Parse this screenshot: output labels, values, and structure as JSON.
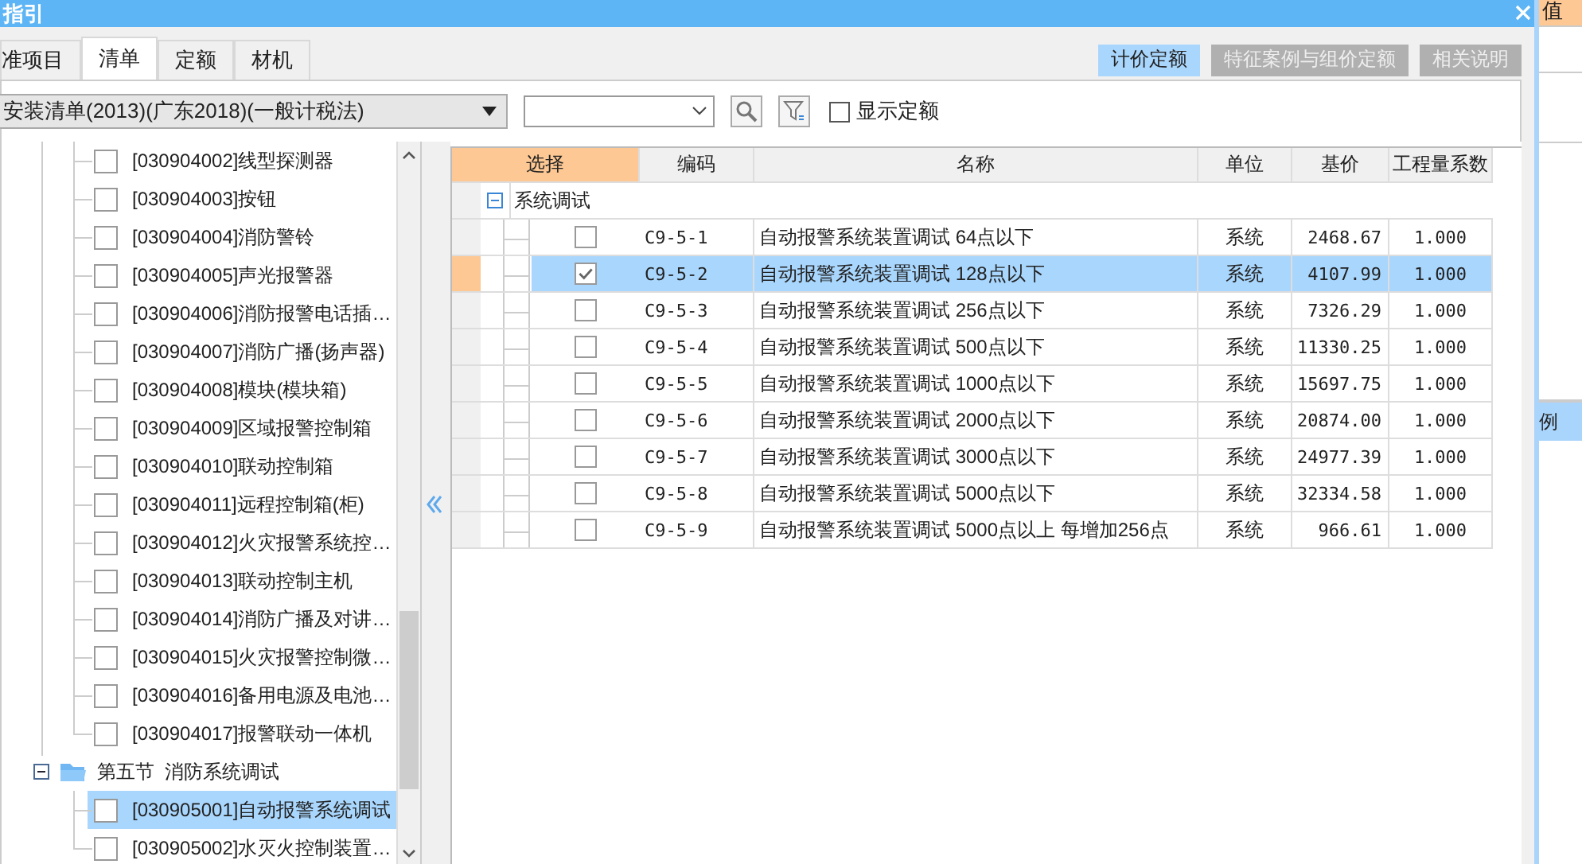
{
  "window": {
    "title": "指引"
  },
  "tabs": [
    {
      "label": "准项目",
      "selected": false
    },
    {
      "label": "清单",
      "selected": true
    },
    {
      "label": "定额",
      "selected": false
    },
    {
      "label": "材机",
      "selected": false
    }
  ],
  "view_buttons": [
    {
      "label": "计价定额",
      "selected": true
    },
    {
      "label": "特征案例与组价定额",
      "selected": false
    },
    {
      "label": "相关说明",
      "selected": false
    }
  ],
  "library": {
    "value": "安装清单(2013)(广东2018)(一般计税法)"
  },
  "show_quota": {
    "label": "显示定额",
    "checked": false
  },
  "tree": [
    {
      "children": [
        {
          "label": "[030904002]线型探测器",
          "checked": false,
          "selected": false
        },
        {
          "label": "[030904003]按钮",
          "checked": false,
          "selected": false
        },
        {
          "label": "[030904004]消防警铃",
          "checked": false,
          "selected": false
        },
        {
          "label": "[030904005]声光报警器",
          "checked": false,
          "selected": false
        },
        {
          "label": "[030904006]消防报警电话插…",
          "checked": false,
          "selected": false
        },
        {
          "label": "[030904007]消防广播(扬声器)",
          "checked": false,
          "selected": false
        },
        {
          "label": "[030904008]模块(模块箱)",
          "checked": false,
          "selected": false
        },
        {
          "label": "[030904009]区域报警控制箱",
          "checked": false,
          "selected": false
        },
        {
          "label": "[030904010]联动控制箱",
          "checked": false,
          "selected": false
        },
        {
          "label": "[030904011]远程控制箱(柜)",
          "checked": false,
          "selected": false
        },
        {
          "label": "[030904012]火灾报警系统控…",
          "checked": false,
          "selected": false
        },
        {
          "label": "[030904013]联动控制主机",
          "checked": false,
          "selected": false
        },
        {
          "label": "[030904014]消防广播及对讲…",
          "checked": false,
          "selected": false
        },
        {
          "label": "[030904015]火灾报警控制微…",
          "checked": false,
          "selected": false
        },
        {
          "label": "[030904016]备用电源及电池…",
          "checked": false,
          "selected": false
        },
        {
          "label": "[030904017]报警联动一体机",
          "checked": false,
          "selected": false
        }
      ]
    },
    {
      "label": "第五节  消防系统调试",
      "expanded": true,
      "children": [
        {
          "label": "[030905001]自动报警系统调试",
          "checked": false,
          "selected": true
        },
        {
          "label": "[030905002]水灭火控制装置…",
          "checked": false,
          "selected": false
        }
      ]
    }
  ],
  "grid": {
    "columns": [
      "选择",
      "编码",
      "名称",
      "单位",
      "基价",
      "工程量系数"
    ],
    "group": {
      "label": "系统调试",
      "expanded": true
    },
    "rows": [
      {
        "checked": false,
        "selected": false,
        "code": "C9-5-1",
        "name": "自动报警系统装置调试 64点以下",
        "unit": "系统",
        "price": "2468.67",
        "factor": "1.000"
      },
      {
        "checked": true,
        "selected": true,
        "code": "C9-5-2",
        "name": "自动报警系统装置调试 128点以下",
        "unit": "系统",
        "price": "4107.99",
        "factor": "1.000"
      },
      {
        "checked": false,
        "selected": false,
        "code": "C9-5-3",
        "name": "自动报警系统装置调试 256点以下",
        "unit": "系统",
        "price": "7326.29",
        "factor": "1.000"
      },
      {
        "checked": false,
        "selected": false,
        "code": "C9-5-4",
        "name": "自动报警系统装置调试 500点以下",
        "unit": "系统",
        "price": "11330.25",
        "factor": "1.000"
      },
      {
        "checked": false,
        "selected": false,
        "code": "C9-5-5",
        "name": "自动报警系统装置调试 1000点以下",
        "unit": "系统",
        "price": "15697.75",
        "factor": "1.000"
      },
      {
        "checked": false,
        "selected": false,
        "code": "C9-5-6",
        "name": "自动报警系统装置调试 2000点以下",
        "unit": "系统",
        "price": "20874.00",
        "factor": "1.000"
      },
      {
        "checked": false,
        "selected": false,
        "code": "C9-5-7",
        "name": "自动报警系统装置调试 3000点以下",
        "unit": "系统",
        "price": "24977.39",
        "factor": "1.000"
      },
      {
        "checked": false,
        "selected": false,
        "code": "C9-5-8",
        "name": "自动报警系统装置调试 5000点以下",
        "unit": "系统",
        "price": "32334.58",
        "factor": "1.000"
      },
      {
        "checked": false,
        "selected": false,
        "code": "C9-5-9",
        "name": "自动报警系统装置调试 5000点以上 每增加256点",
        "unit": "系统",
        "price": "966.61",
        "factor": "1.000"
      }
    ]
  },
  "background_app": {
    "header_cell": "值",
    "tab": "例"
  }
}
